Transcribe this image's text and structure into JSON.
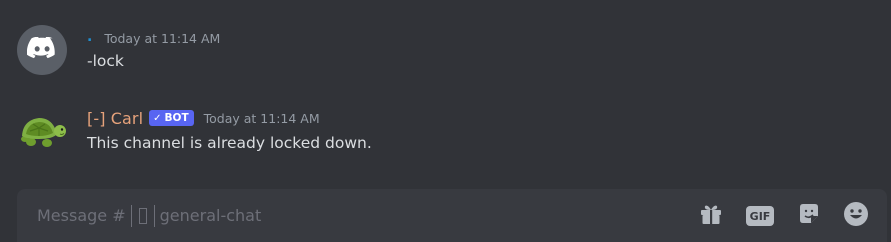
{
  "messages": [
    {
      "username": ".",
      "timestamp": "Today at 11:14 AM",
      "content": "-lock",
      "avatar_icon": "discord-logo-icon"
    },
    {
      "username": "[-] Carl",
      "badge": {
        "check": "✓",
        "label": "BOT"
      },
      "timestamp": "Today at 11:14 AM",
      "content": "This channel is already locked down.",
      "avatar_icon": "turtle-icon"
    }
  ],
  "composer": {
    "placeholder_prefix": "Message #",
    "placeholder_channel": "general-chat",
    "icons": [
      "gift-icon",
      "gif-icon",
      "sticker-icon",
      "emoji-icon"
    ],
    "gif_label": "GIF"
  },
  "colors": {
    "background": "#313338",
    "composer": "#383a40",
    "bot_badge": "#5865f2",
    "carl_name": "#e6a27b",
    "dot_name": "#1f8fd1",
    "icon": "#b5bac1"
  }
}
